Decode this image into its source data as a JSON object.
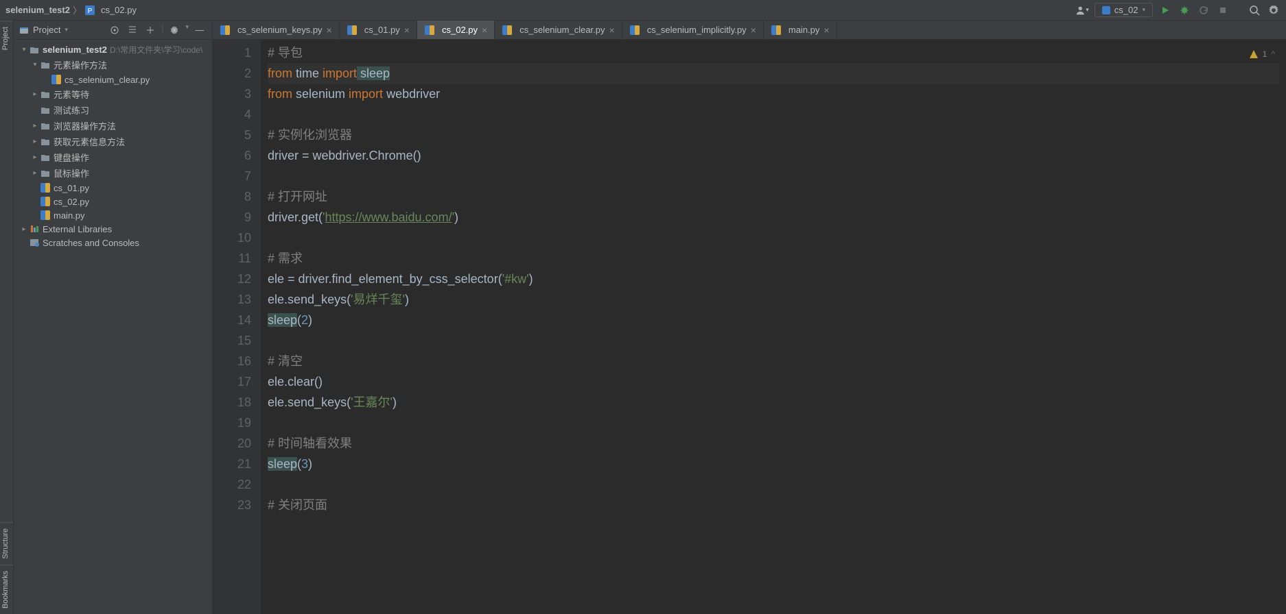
{
  "toolbar": {
    "breadcrumb": [
      "selenium_test2",
      "cs_02.py"
    ],
    "run_config": "cs_02"
  },
  "side_tabs": [
    "Project",
    "Structure",
    "Bookmarks"
  ],
  "project": {
    "title": "Project",
    "tree": {
      "root": {
        "label": "selenium_test2",
        "path": "D:\\常用文件夹\\学习\\code\\"
      },
      "folders": [
        {
          "label": "元素操作方法",
          "expanded": true,
          "children": [
            "cs_selenium_clear.py"
          ]
        },
        {
          "label": "元素等待",
          "expanded": false
        },
        {
          "label": "测试练习",
          "expanded": null
        },
        {
          "label": "浏览器操作方法",
          "expanded": false
        },
        {
          "label": "获取元素信息方法",
          "expanded": false
        },
        {
          "label": "键盘操作",
          "expanded": false
        },
        {
          "label": "鼠标操作",
          "expanded": false
        }
      ],
      "files": [
        "cs_01.py",
        "cs_02.py",
        "main.py"
      ],
      "external": "External Libraries",
      "scratches": "Scratches and Consoles"
    }
  },
  "tabs": [
    {
      "label": "cs_selenium_keys.py",
      "active": false
    },
    {
      "label": "cs_01.py",
      "active": false
    },
    {
      "label": "cs_02.py",
      "active": true
    },
    {
      "label": "cs_selenium_clear.py",
      "active": false
    },
    {
      "label": "cs_selenium_implicitly.py",
      "active": false
    },
    {
      "label": "main.py",
      "active": false
    }
  ],
  "editor": {
    "status": {
      "warnings": "1",
      "marker": "^"
    },
    "current_line": 2,
    "lines": [
      {
        "n": 1,
        "tokens": [
          {
            "t": "comment",
            "v": "# 导包"
          }
        ]
      },
      {
        "n": 2,
        "tokens": [
          {
            "t": "keyword",
            "v": "from"
          },
          {
            "t": "ident",
            "v": " time "
          },
          {
            "t": "keyword",
            "v": "import"
          },
          {
            "t": "used",
            "v": " sleep"
          }
        ]
      },
      {
        "n": 3,
        "tokens": [
          {
            "t": "keyword",
            "v": "from"
          },
          {
            "t": "ident",
            "v": " selenium "
          },
          {
            "t": "keyword",
            "v": "import"
          },
          {
            "t": "ident",
            "v": " webdriver"
          }
        ]
      },
      {
        "n": 4,
        "tokens": []
      },
      {
        "n": 5,
        "tokens": [
          {
            "t": "comment",
            "v": "# 实例化浏览器"
          }
        ]
      },
      {
        "n": 6,
        "tokens": [
          {
            "t": "ident",
            "v": "driver = webdriver.Chrome()"
          }
        ]
      },
      {
        "n": 7,
        "tokens": []
      },
      {
        "n": 8,
        "tokens": [
          {
            "t": "comment",
            "v": "# 打开网址"
          }
        ]
      },
      {
        "n": 9,
        "tokens": [
          {
            "t": "ident",
            "v": "driver.get("
          },
          {
            "t": "string",
            "v": "'"
          },
          {
            "t": "string-u",
            "v": "https://www.baidu.com/"
          },
          {
            "t": "string",
            "v": "'"
          },
          {
            "t": "ident",
            "v": ")"
          }
        ]
      },
      {
        "n": 10,
        "tokens": []
      },
      {
        "n": 11,
        "tokens": [
          {
            "t": "comment",
            "v": "# 需求"
          }
        ]
      },
      {
        "n": 12,
        "tokens": [
          {
            "t": "ident",
            "v": "ele = driver.find_element_by_css_selector("
          },
          {
            "t": "string",
            "v": "'#kw'"
          },
          {
            "t": "ident",
            "v": ")"
          }
        ]
      },
      {
        "n": 13,
        "tokens": [
          {
            "t": "ident",
            "v": "ele.send_keys("
          },
          {
            "t": "string",
            "v": "'易烊千玺'"
          },
          {
            "t": "ident",
            "v": ")"
          }
        ]
      },
      {
        "n": 14,
        "tokens": [
          {
            "t": "used",
            "v": "sleep"
          },
          {
            "t": "ident",
            "v": "("
          },
          {
            "t": "num",
            "v": "2"
          },
          {
            "t": "ident",
            "v": ")"
          }
        ]
      },
      {
        "n": 15,
        "tokens": []
      },
      {
        "n": 16,
        "tokens": [
          {
            "t": "comment",
            "v": "# 清空"
          }
        ]
      },
      {
        "n": 17,
        "tokens": [
          {
            "t": "ident",
            "v": "ele.clear()"
          }
        ]
      },
      {
        "n": 18,
        "tokens": [
          {
            "t": "ident",
            "v": "ele.send_keys("
          },
          {
            "t": "string",
            "v": "'王嘉尔'"
          },
          {
            "t": "ident",
            "v": ")"
          }
        ]
      },
      {
        "n": 19,
        "tokens": []
      },
      {
        "n": 20,
        "tokens": [
          {
            "t": "comment",
            "v": "# 时间轴看效果"
          }
        ]
      },
      {
        "n": 21,
        "tokens": [
          {
            "t": "used",
            "v": "sleep"
          },
          {
            "t": "ident",
            "v": "("
          },
          {
            "t": "num",
            "v": "3"
          },
          {
            "t": "ident",
            "v": ")"
          }
        ]
      },
      {
        "n": 22,
        "tokens": []
      },
      {
        "n": 23,
        "tokens": [
          {
            "t": "comment",
            "v": "# 关闭页面"
          }
        ]
      }
    ]
  }
}
